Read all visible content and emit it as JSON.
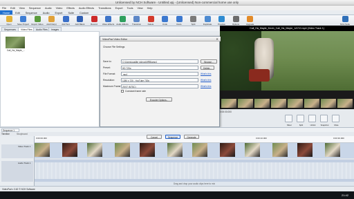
{
  "window_title": "Unlicensed by NCH Software - Untitled.vpj - (Unlicensed) Non-commercial home use only",
  "menu": [
    "File",
    "Edit",
    "View",
    "Sequence",
    "Audio",
    "Video",
    "Effects",
    "Audio Effects",
    "Transitions",
    "Export",
    "Tools",
    "View",
    "Help"
  ],
  "ribbon_tabs": [
    "Home",
    "Edit",
    "Sequence",
    "Audio",
    "Export",
    "Suite",
    "Custom"
  ],
  "toolbar": [
    {
      "label": "Open",
      "icon": "folder-icon",
      "color": "#e2b23a"
    },
    {
      "label": "Save Project",
      "icon": "save-icon",
      "color": "#3f7ed4"
    },
    {
      "label": "Export Video",
      "icon": "export-video-icon",
      "color": "#5a9b3d"
    },
    {
      "label": "Add File(s)",
      "icon": "add-file-icon",
      "color": "#e0a23a"
    },
    {
      "label": "Add Text",
      "icon": "text-icon",
      "color": "#3a6fc8"
    },
    {
      "label": "Add Blank",
      "icon": "blank-icon",
      "color": "#2f5fb3"
    },
    {
      "label": "Record",
      "icon": "record-icon",
      "color": "#cc2a2a"
    },
    {
      "label": "Video Effects",
      "icon": "video-effects-icon",
      "color": "#3c74c8"
    },
    {
      "label": "Audio Effects",
      "icon": "audio-effects-icon",
      "color": "#2e9f5e"
    },
    {
      "label": "Transition",
      "icon": "transition-icon",
      "color": "#5b86c7"
    },
    {
      "label": "Delete",
      "icon": "delete-icon",
      "color": "#d33a2c"
    },
    {
      "label": "Undo",
      "icon": "undo-icon",
      "color": "#3b78cf"
    },
    {
      "label": "Redo",
      "icon": "redo-icon",
      "color": "#3b78cf"
    },
    {
      "label": "Split",
      "icon": "split-icon",
      "color": "#7a7a7a"
    },
    {
      "label": "Duplicate",
      "icon": "duplicate-icon",
      "color": "#4c8ad1"
    },
    {
      "label": "Preview",
      "icon": "preview-icon",
      "color": "#2f8bd1"
    },
    {
      "label": "Options",
      "icon": "options-icon",
      "color": "#6c6c6c"
    },
    {
      "label": "Upgrade",
      "icon": "upgrade-icon",
      "color": "#e28b2a"
    },
    {
      "label": "NCH Suite",
      "icon": "nch-suite-icon",
      "color": "#2f6fb8"
    }
  ],
  "bin_tabs": [
    "Sequences",
    "Video Files",
    "Audio Files",
    "Images"
  ],
  "clip": {
    "name": "Cali_Ha_Mayte_..."
  },
  "preview_tabs": [
    "Clip Preview",
    "Sequence Preview"
  ],
  "video_title": "Cali_Ha_Mayte_Kevin_Cali_Ha_Mayte_1A710.mp4 (Video Track 1)",
  "video_timecode": "0:00:00.000",
  "dialog": {
    "title": "VideoPad Video Editor",
    "subtitle": "Choose File Settings",
    "save_to_label": "Save to:",
    "save_to_value": "C:\\Users\\pasilite videos\\MRBlamp4",
    "browse_label": "Browse...",
    "preset_label": "Preset:",
    "preset_value": "HD 720p",
    "delete_label": "Delete...",
    "file_format_label": "File Format:",
    "file_format_value": ".mp4",
    "whats_this": "What's this",
    "resolution_label": "Resolution:",
    "resolution_value": "1280 x 720 - YouTube 720p",
    "frame_rate_label": "Maximum Frame Rate:",
    "frame_rate_value": "29.97 (NTSC)",
    "constant_label": "Constant frame rate",
    "encoder_label": "Encoder Options..."
  },
  "controls": [
    "Mixer",
    "Split",
    "Unlink",
    "Snapshot",
    "Mute"
  ],
  "timeline": {
    "title": "Sequence 1",
    "tabs": [
      "Timeline",
      "Storyboard"
    ],
    "time_start": "0:00:00.000",
    "time_mid": "0:00:10.000",
    "time_end": "0:00:30.000",
    "video_track": "Video Track 1",
    "audio_track": "Audio Track 1",
    "drop_hint": "Drag and drop your audio clips here to mix",
    "overlay_btns": [
      "Cancel",
      "Sequence",
      "Generate"
    ]
  },
  "status": "VideoPad v 3.62 © NCH Software",
  "clock": "21:42"
}
